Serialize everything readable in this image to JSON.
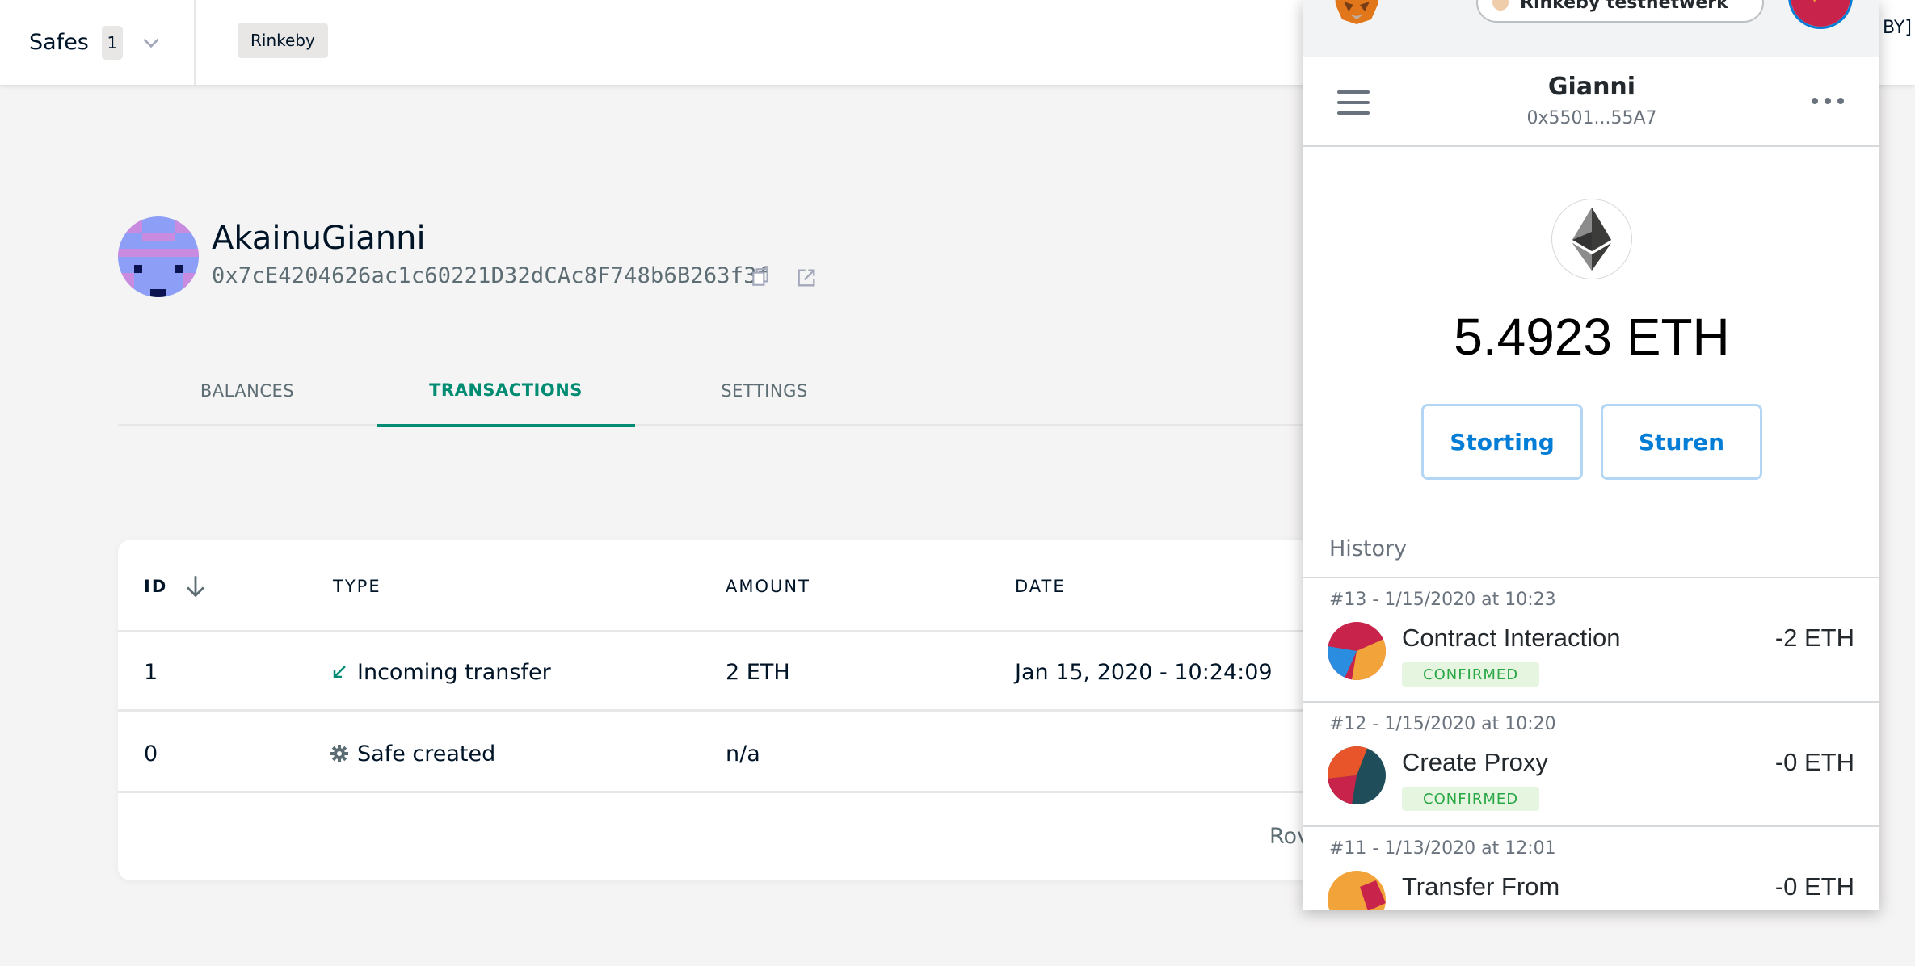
{
  "header": {
    "safes_label": "Safes",
    "safes_count": "1",
    "network": "Rinkeby",
    "right_fragment": "BY]"
  },
  "safe": {
    "name": "AkainuGianni",
    "address": "0x7cE4204626ac1c60221D32dCAc8F748b6B263f3f"
  },
  "tabs": [
    {
      "label": "BALANCES",
      "active": false
    },
    {
      "label": "TRANSACTIONS",
      "active": true
    },
    {
      "label": "SETTINGS",
      "active": false
    }
  ],
  "table": {
    "columns": [
      "ID",
      "TYPE",
      "AMOUNT",
      "DATE"
    ],
    "rows": [
      {
        "id": "1",
        "type": "Incoming transfer",
        "type_icon": "incoming-arrow-icon",
        "amount": "2 ETH",
        "date": "Jan 15, 2020 - 10:24:09"
      },
      {
        "id": "0",
        "type": "Safe created",
        "type_icon": "gear-icon",
        "amount": "n/a",
        "date": ""
      }
    ],
    "footer_fragment": "Rov"
  },
  "metamask": {
    "network": "Rinkeby testnetwerk",
    "account_name": "Gianni",
    "account_address": "0x5501...55A7",
    "balance": "5.4923 ETH",
    "buttons": {
      "deposit": "Storting",
      "send": "Sturen"
    },
    "history_label": "History",
    "history": [
      {
        "date": "#13 - 1/15/2020 at 10:23",
        "title": "Contract Interaction",
        "amount": "-2 ETH",
        "status": "CONFIRMED"
      },
      {
        "date": "#12 - 1/15/2020 at 10:20",
        "title": "Create Proxy",
        "amount": "-0 ETH",
        "status": "CONFIRMED"
      },
      {
        "date": "#11 - 1/13/2020 at 12:01",
        "title": "Transfer From",
        "amount": "-0 ETH",
        "status": ""
      }
    ]
  },
  "colors": {
    "accent": "#008c73",
    "metamask_blue": "#037dd6",
    "confirmed_bg": "#e5f5e0",
    "confirmed_fg": "#28a745"
  }
}
